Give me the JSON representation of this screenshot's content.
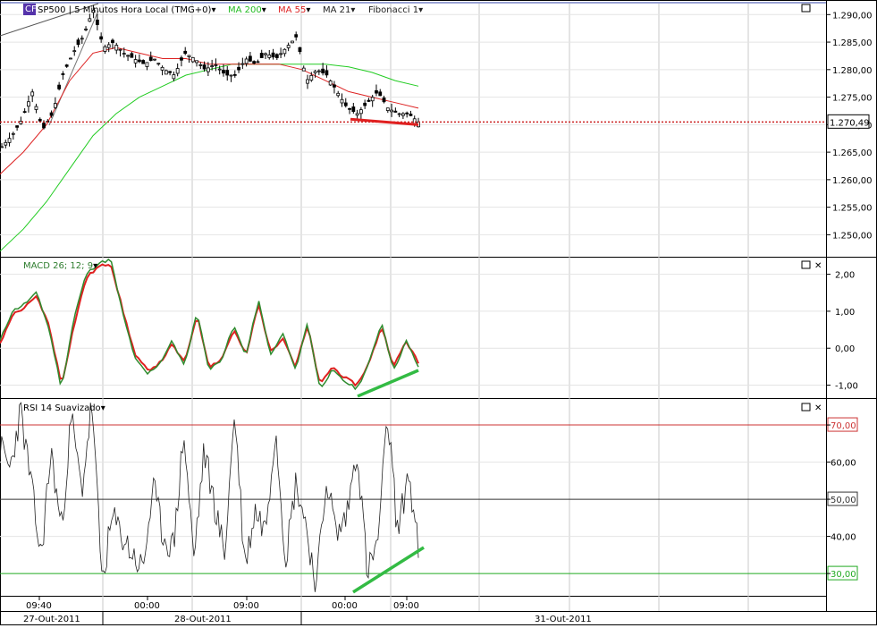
{
  "header": {
    "symbol": "SP500",
    "interval": "5 Minutos",
    "timezone": "Hora Local (TMG+0)",
    "indicators": [
      {
        "label": "MA 200",
        "color": "#22bb22"
      },
      {
        "label": "MA 55",
        "color": "#dd2222"
      },
      {
        "label": "MA 21",
        "color": "#222222"
      },
      {
        "label": "Fibonacci 1",
        "color": "#222222"
      }
    ]
  },
  "price_panel": {
    "current_price": "1.270,49",
    "ticks": [
      "1.290,00",
      "1.285,00",
      "1.280,00",
      "1.275,00",
      "1.270,00",
      "1.265,00",
      "1.260,00",
      "1.255,00",
      "1.250,00"
    ]
  },
  "macd_panel": {
    "label": "MACD 26; 12; 9",
    "ticks": [
      "2,00",
      "1,00",
      "0,00",
      "-1,00"
    ]
  },
  "rsi_panel": {
    "label": "RSI 14 Suavizado",
    "ticks": [
      "70,00",
      "60,00",
      "50,00",
      "40,00",
      "30,00"
    ],
    "levels": {
      "overbought": 70,
      "middle": 50,
      "oversold": 30
    }
  },
  "time_axis": {
    "hours": [
      "09:40",
      "00:00",
      "09:00",
      "00:00",
      "09:00"
    ],
    "dates": [
      "27-Out-2011",
      "28-Out-2011",
      "31-Out-2011"
    ]
  },
  "colors": {
    "macd_line": "#2e8b2e",
    "signal_line": "#e02020",
    "ma200": "#22cc22",
    "ma55": "#dd2222",
    "divergence_price": "#e02020",
    "divergence_indicator": "#33bb44",
    "current_price_line": "#cc2222"
  },
  "chart_data": [
    {
      "type": "candlestick",
      "title": "SP500 5 Minutos",
      "ylim": [
        1246,
        1292
      ],
      "close_path": [
        1266,
        1268,
        1271,
        1276,
        1269,
        1272,
        1279,
        1283,
        1286,
        1291,
        1284,
        1285,
        1283,
        1282,
        1281,
        1282,
        1280,
        1279,
        1283,
        1282,
        1280,
        1281,
        1279,
        1279,
        1282,
        1281,
        1283,
        1282,
        1284,
        1286,
        1278,
        1280,
        1279,
        1276,
        1273,
        1272,
        1274,
        1276,
        1273,
        1272,
        1272,
        1270.5
      ],
      "ma200_path": [
        1247,
        1251,
        1256,
        1262,
        1268,
        1272,
        1275,
        1277,
        1279,
        1280,
        1281,
        1281,
        1281,
        1281,
        1281,
        1280.5,
        1279.5,
        1278,
        1277
      ],
      "ma55_path": [
        1261,
        1265,
        1270,
        1278,
        1283,
        1284,
        1283,
        1282,
        1282,
        1281,
        1281,
        1281,
        1281,
        1280,
        1278,
        1276,
        1275,
        1274,
        1273
      ],
      "divergence": {
        "from": 1271,
        "to": 1270
      }
    },
    {
      "type": "line",
      "title": "MACD 26; 12; 9",
      "ylim": [
        -1.35,
        2.45
      ],
      "series": [
        {
          "values": [
            0.2,
            1.0,
            1.2,
            1.5,
            0.5,
            -1.1,
            0.8,
            2.0,
            2.3,
            2.4,
            0.9,
            -0.3,
            -0.7,
            -0.4,
            0.2,
            -0.5,
            1.0,
            -0.6,
            -0.3,
            0.6,
            -0.2,
            1.3,
            -0.2,
            0.4,
            -0.6,
            0.7,
            -1.1,
            -0.6,
            -0.9,
            -1.1,
            -0.4,
            0.7,
            -0.6,
            0.2,
            -0.5
          ]
        },
        {
          "values": [
            0.1,
            0.9,
            1.1,
            1.4,
            0.6,
            -1.0,
            0.6,
            1.9,
            2.2,
            2.3,
            1.0,
            -0.2,
            -0.6,
            -0.4,
            0.1,
            -0.4,
            0.9,
            -0.5,
            -0.3,
            0.5,
            -0.2,
            1.2,
            -0.1,
            0.3,
            -0.5,
            0.6,
            -1.0,
            -0.5,
            -0.8,
            -1.0,
            -0.4,
            0.6,
            -0.5,
            0.2,
            -0.4
          ]
        }
      ],
      "divergence": {
        "from": -1.3,
        "to": -0.6
      }
    },
    {
      "type": "line",
      "title": "RSI 14 Suavizado",
      "ylim": [
        24,
        77
      ],
      "series": [
        {
          "values": [
            64,
            58,
            74,
            55,
            34,
            63,
            42,
            72,
            52,
            76,
            28,
            45,
            40,
            35,
            31,
            53,
            40,
            37,
            68,
            34,
            63,
            49,
            35,
            74,
            32,
            47,
            42,
            70,
            34,
            55,
            43,
            26,
            56,
            40,
            46,
            64,
            30,
            38,
            72,
            40,
            58,
            36
          ]
        }
      ],
      "divergence": {
        "from": 25,
        "to": 37
      }
    }
  ]
}
